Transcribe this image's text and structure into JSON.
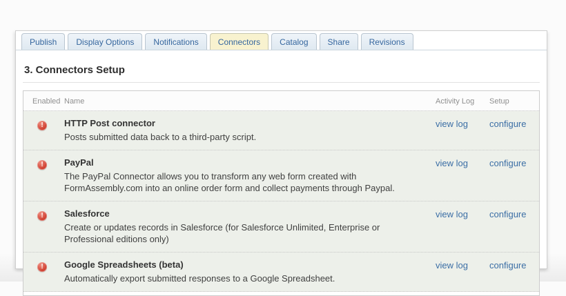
{
  "window": {
    "heading": "3. Connectors Setup"
  },
  "tabs": [
    {
      "label": "Publish",
      "active": false
    },
    {
      "label": "Display Options",
      "active": false
    },
    {
      "label": "Notifications",
      "active": false
    },
    {
      "label": "Connectors",
      "active": true
    },
    {
      "label": "Catalog",
      "active": false
    },
    {
      "label": "Share",
      "active": false
    },
    {
      "label": "Revisions",
      "active": false
    }
  ],
  "table": {
    "headers": {
      "enabled": "Enabled",
      "name": "Name",
      "activity_log": "Activity Log",
      "setup": "Setup"
    },
    "rows": [
      {
        "status_icon": "alert-icon",
        "name": "HTTP Post connector",
        "description": "Posts submitted data back to a third-party script.",
        "activity_link": "view log",
        "setup_link": "configure"
      },
      {
        "status_icon": "alert-icon",
        "name": "PayPal",
        "description": "The PayPal Connector allows you to transform any web form created with FormAssembly.com into an online order form and collect payments through Paypal.",
        "activity_link": "view log",
        "setup_link": "configure"
      },
      {
        "status_icon": "alert-icon",
        "name": "Salesforce",
        "description": "Create or updates records in Salesforce (for Salesforce Unlimited, Enterprise or Professional editions only)",
        "activity_link": "view log",
        "setup_link": "configure"
      },
      {
        "status_icon": "alert-icon",
        "name": "Google Spreadsheets (beta)",
        "description": "Automatically export submitted responses to a Google Spreadsheet.",
        "activity_link": "view log",
        "setup_link": "configure"
      }
    ]
  },
  "icons": {
    "alert_glyph": "!"
  },
  "colors": {
    "link": "#3b6ea5",
    "tab_text": "#35669e",
    "active_tab_bg": "#f8f2cf",
    "inactive_tab_bg": "#dfe9f1",
    "alert_red": "#cc3a2b",
    "row_bg": "#edf0ea"
  }
}
